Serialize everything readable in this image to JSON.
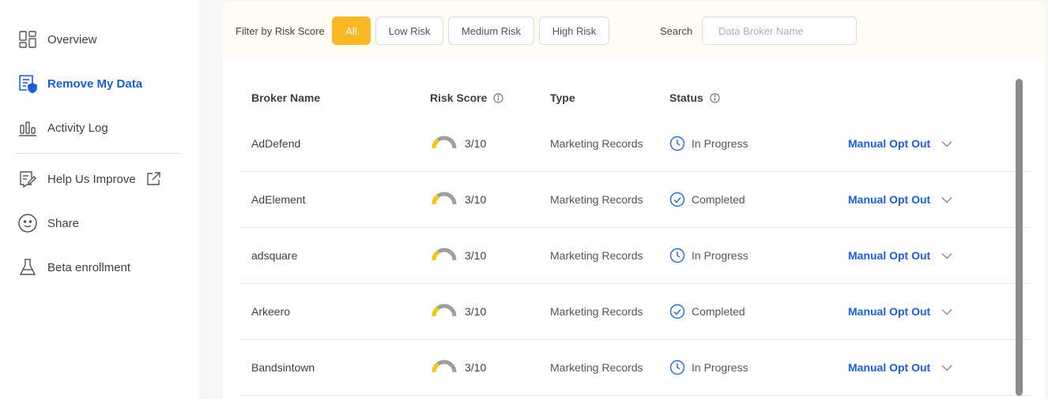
{
  "sidebar": {
    "items": [
      {
        "label": "Overview",
        "icon": "dashboard-grid-icon"
      },
      {
        "label": "Remove My Data",
        "icon": "document-shield-icon",
        "active": true
      },
      {
        "label": "Activity Log",
        "icon": "bar-chart-icon"
      },
      {
        "label": "Help Us Improve",
        "icon": "feedback-edit-icon",
        "trailing_icon": "external-link-icon"
      },
      {
        "label": "Share",
        "icon": "smiley-face-icon"
      },
      {
        "label": "Beta enrollment",
        "icon": "flask-icon"
      }
    ]
  },
  "filters": {
    "label": "Filter by Risk Score",
    "options": [
      "All",
      "Low Risk",
      "Medium Risk",
      "High Risk"
    ],
    "selected": "All"
  },
  "search": {
    "label": "Search",
    "placeholder": "Data Broker Name",
    "value": ""
  },
  "table": {
    "headers": {
      "broker": "Broker Name",
      "risk": "Risk Score",
      "type": "Type",
      "status": "Status"
    },
    "rows": [
      {
        "name": "AdDefend",
        "risk": "3/10",
        "risk_value": 3,
        "type": "Marketing Records",
        "status": "In Progress",
        "status_icon": "clock-icon",
        "action": "Manual Opt Out"
      },
      {
        "name": "AdElement",
        "risk": "3/10",
        "risk_value": 3,
        "type": "Marketing Records",
        "status": "Completed",
        "status_icon": "check-circle-icon",
        "action": "Manual Opt Out"
      },
      {
        "name": "adsquare",
        "risk": "3/10",
        "risk_value": 3,
        "type": "Marketing Records",
        "status": "In Progress",
        "status_icon": "clock-icon",
        "action": "Manual Opt Out"
      },
      {
        "name": "Arkeero",
        "risk": "3/10",
        "risk_value": 3,
        "type": "Marketing Records",
        "status": "Completed",
        "status_icon": "check-circle-icon",
        "action": "Manual Opt Out"
      },
      {
        "name": "Bandsintown",
        "risk": "3/10",
        "risk_value": 3,
        "type": "Marketing Records",
        "status": "In Progress",
        "status_icon": "clock-icon",
        "action": "Manual Opt Out"
      }
    ]
  },
  "colors": {
    "accent": "#1a5fd8",
    "filter_active": "#f9b824",
    "gauge_fill": "#f5c518",
    "gauge_track": "#9e9e9e",
    "status_icon": "#2a6fd6"
  }
}
